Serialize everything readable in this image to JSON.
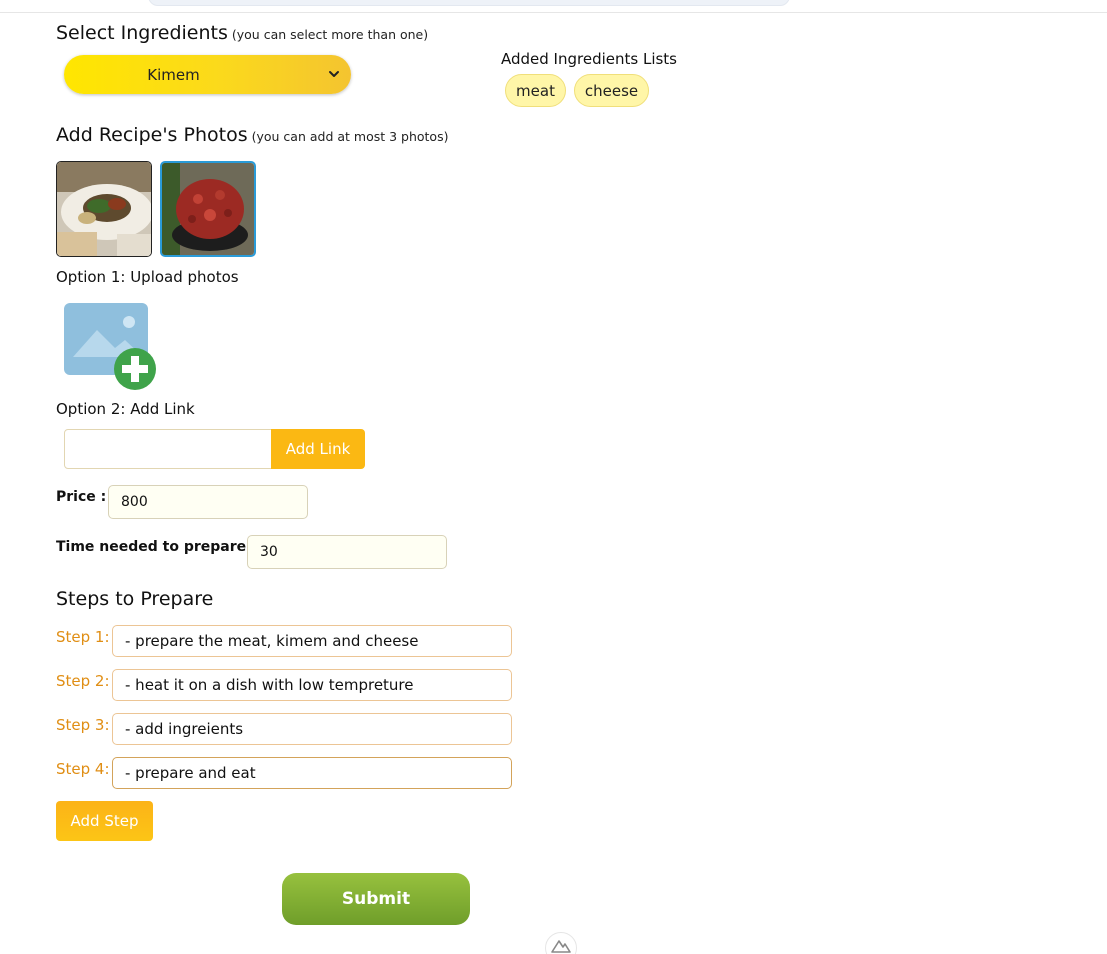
{
  "ingredients": {
    "heading": "Select Ingredients",
    "note": "(you can select more than one)",
    "selected": "Kimem",
    "added_title": "Added Ingredients Lists",
    "added": [
      "meat",
      "cheese"
    ]
  },
  "photos": {
    "heading": "Add Recipe's Photos",
    "note": "(you can add at most 3 photos)",
    "option1": "Option 1: Upload photos",
    "option2": "Option 2: Add Link",
    "link_value": "",
    "add_link_label": "Add Link",
    "upload_icon": "image-add-icon"
  },
  "price": {
    "label": "Price :",
    "value": "800"
  },
  "time": {
    "label": "Time needed to prepare :",
    "value": "30"
  },
  "steps": {
    "heading": "Steps to Prepare",
    "items": [
      {
        "label": "Step 1:",
        "value": "- prepare the meat, kimem and cheese"
      },
      {
        "label": "Step 2:",
        "value": "- heat it on a dish with low tempreture"
      },
      {
        "label": "Step 3:",
        "value": "- add ingreients"
      },
      {
        "label": "Step 4:",
        "value": "- prepare and eat"
      }
    ],
    "add_step_label": "Add Step"
  },
  "submit_label": "Submit",
  "colors": {
    "accent": "#fbb813",
    "step_label": "#e08e14",
    "submit": "#7aa830",
    "chip": "#fff6a8",
    "selected_border": "#2a9bd8"
  }
}
